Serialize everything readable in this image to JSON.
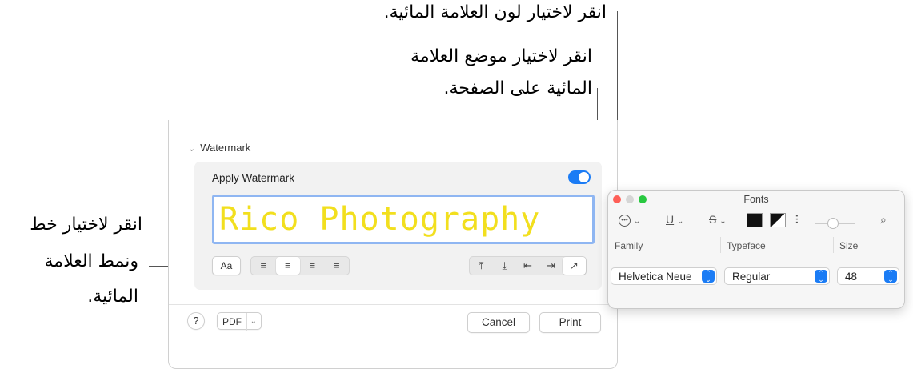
{
  "callouts": {
    "color": "انقر لاختيار لون العلامة المائية.",
    "position_line1": "انقر لاختيار موضع العلامة",
    "position_line2": "المائية على الصفحة.",
    "font_line1": "انقر لاختيار خط",
    "font_line2": "ونمط العلامة",
    "font_line3": "المائية."
  },
  "dialog": {
    "section_title": "Watermark",
    "apply_label": "Apply Watermark",
    "apply_on": true,
    "watermark_text": "Rico Photography",
    "font_button": "Aa",
    "align_icons": [
      "≡",
      "≡",
      "≡",
      "≡"
    ],
    "position_icons": [
      "⤒",
      "⤓",
      "⇤",
      "⇥",
      "↗"
    ],
    "help_label": "?",
    "pdf_label": "PDF",
    "cancel_label": "Cancel",
    "print_label": "Print"
  },
  "fonts_panel": {
    "title": "Fonts",
    "toolbar": {
      "underline": "U",
      "strike": "S"
    },
    "columns": [
      "Family",
      "Typeface",
      "Size"
    ],
    "family_value": "Helvetica Neue",
    "typeface_value": "Regular",
    "size_value": "48"
  },
  "colors": {
    "accent": "#1b7cf5",
    "watermark": "#f2df1e",
    "close": "#fe5f57",
    "min": "#d6d6d6",
    "zoom": "#28c840"
  }
}
